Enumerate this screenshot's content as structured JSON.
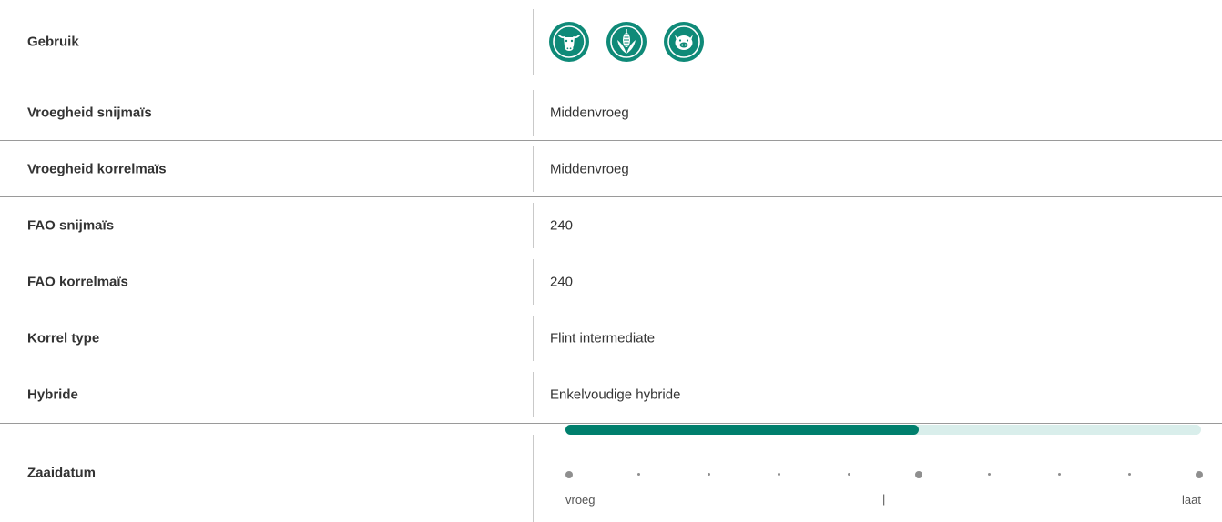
{
  "rows": [
    {
      "label": "Gebruik"
    },
    {
      "label": "Vroegheid snijmaïs",
      "value": "Middenvroeg"
    },
    {
      "label": "Vroegheid korrelmaïs",
      "value": "Middenvroeg"
    },
    {
      "label": "FAO snijmaïs",
      "value": "240"
    },
    {
      "label": "FAO korrelmaïs",
      "value": "240"
    },
    {
      "label": "Korrel type",
      "value": "Flint intermediate"
    },
    {
      "label": "Hybride",
      "value": "Enkelvoudige hybride"
    },
    {
      "label": "Zaaidatum"
    }
  ],
  "usage_icons": [
    "cow-icon",
    "corn-icon",
    "pig-icon"
  ],
  "slider": {
    "fill_fraction": 0.556,
    "steps": 10,
    "major_steps": [
      0,
      5,
      9
    ],
    "start_label": "vroeg",
    "mid_label": "|",
    "end_label": "laat"
  },
  "colors": {
    "accent": "#0f8a78",
    "slider_fill": "#007f6d",
    "slider_track": "#d9eeeb",
    "divider": "#9a9a9a"
  }
}
